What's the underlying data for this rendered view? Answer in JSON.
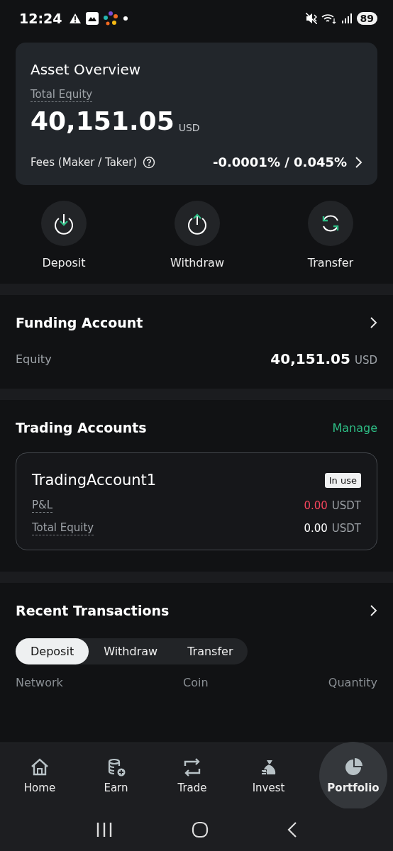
{
  "status_bar": {
    "time": "12:24",
    "battery": "89"
  },
  "asset_overview": {
    "title": "Asset Overview",
    "equity_label": "Total Equity",
    "equity": "40,151.05",
    "currency": "USD",
    "fees_label": "Fees (Maker / Taker)",
    "fees": "-0.0001% / 0.045%"
  },
  "actions": [
    {
      "kind": "deposit",
      "label": "Deposit"
    },
    {
      "kind": "withdraw",
      "label": "Withdraw"
    },
    {
      "kind": "transfer",
      "label": "Transfer"
    }
  ],
  "funding_account": {
    "title": "Funding Account",
    "equity_label": "Equity",
    "equity": "40,151.05",
    "currency": "USD"
  },
  "trading_accounts": {
    "title": "Trading Accounts",
    "action": "Manage",
    "accounts": [
      {
        "name": "TradingAccount1",
        "badge": "In use",
        "rows": [
          {
            "label": "P&L",
            "value": "0.00",
            "currency": "USDT",
            "color": "#f6465d"
          },
          {
            "label": "Total Equity",
            "value": "0.00",
            "currency": "USDT",
            "color": "#ffffff"
          }
        ]
      }
    ]
  },
  "recent_transactions": {
    "title": "Recent Transactions",
    "tabs": [
      {
        "label": "Deposit",
        "selected": true
      },
      {
        "label": "Withdraw",
        "selected": false
      },
      {
        "label": "Transfer",
        "selected": false
      }
    ],
    "columns": [
      "Network",
      "Coin",
      "Quantity"
    ]
  },
  "bottom_nav": [
    {
      "kind": "home",
      "label": "Home",
      "selected": false
    },
    {
      "kind": "earn",
      "label": "Earn",
      "selected": false
    },
    {
      "kind": "trade",
      "label": "Trade",
      "selected": false
    },
    {
      "kind": "invest",
      "label": "Invest",
      "selected": false
    },
    {
      "kind": "portfolio",
      "label": "Portfolio",
      "selected": true
    }
  ]
}
